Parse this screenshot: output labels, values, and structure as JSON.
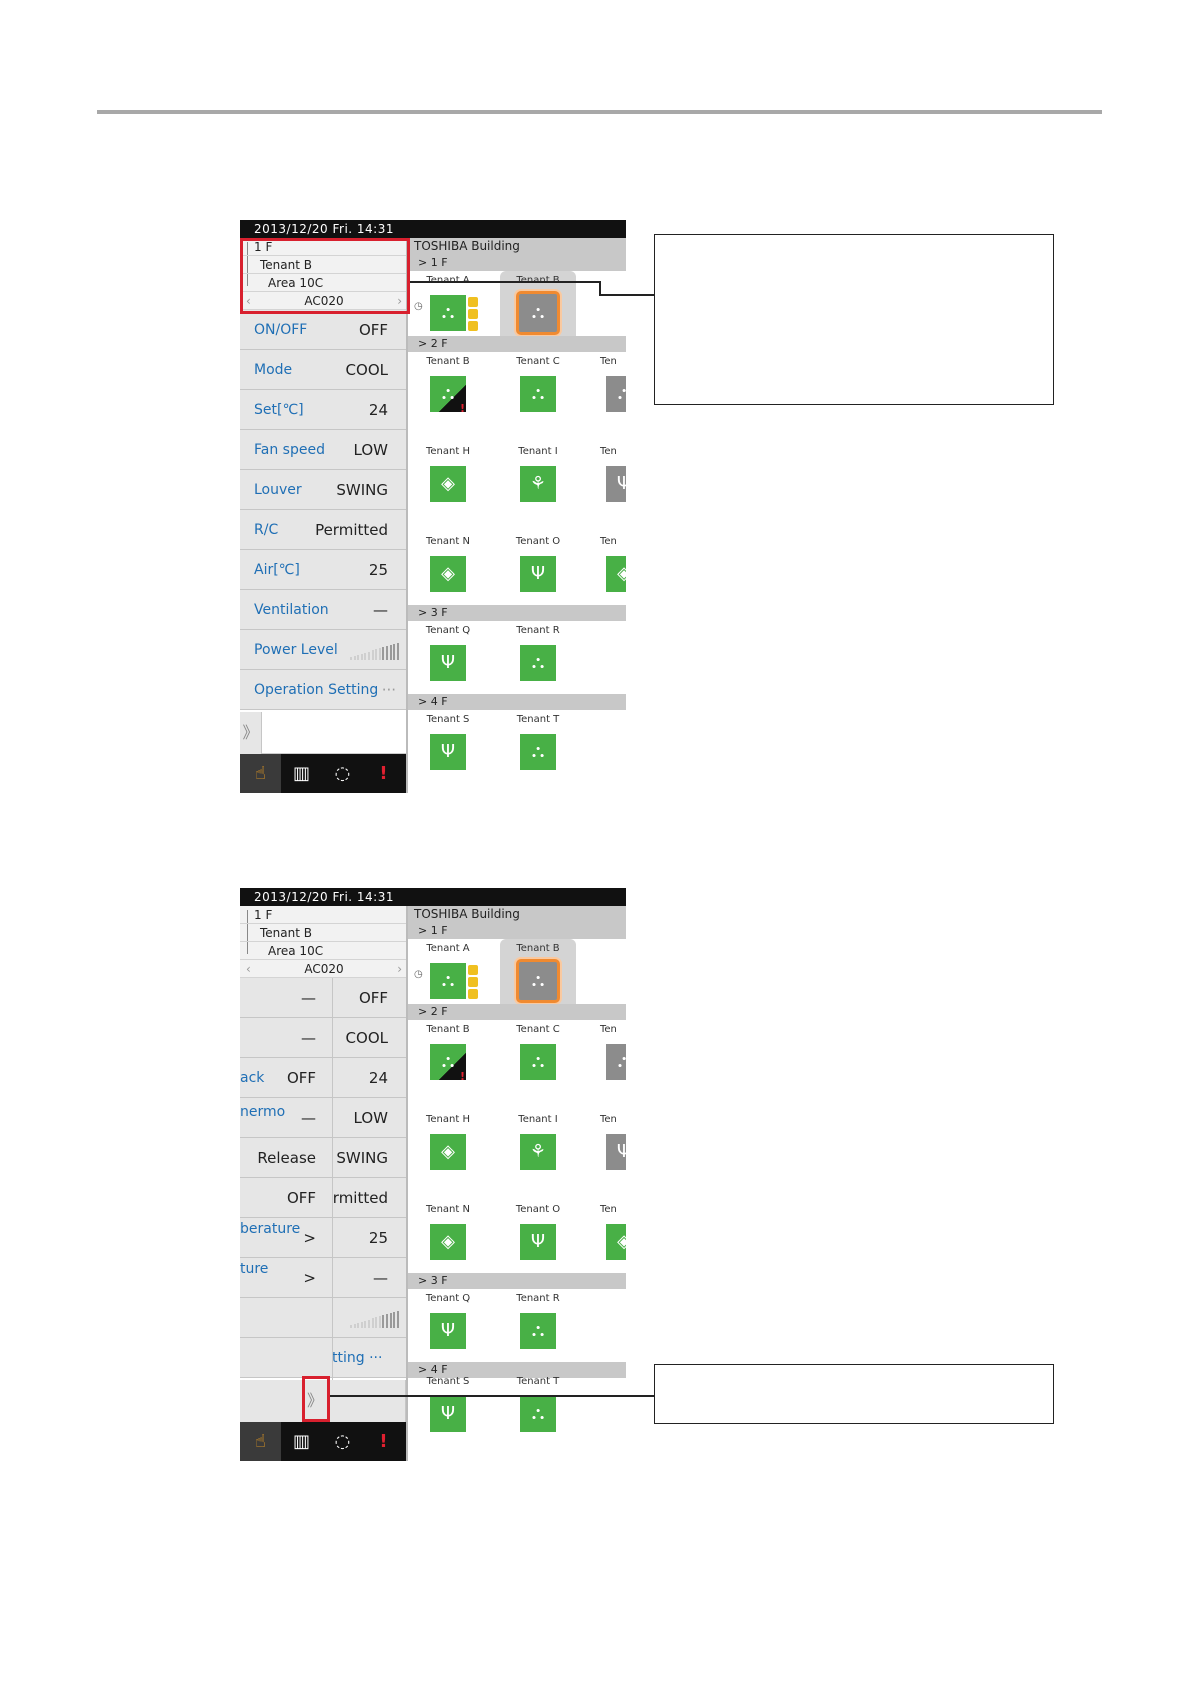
{
  "screen": {
    "datetime": "2013/12/20  Fri.  14:31",
    "tree": {
      "floor": "1 F",
      "tenant": "Tenant B",
      "area": "Area 10C",
      "unit": "AC020"
    },
    "settings": [
      {
        "label": "ON/OFF",
        "value": "OFF"
      },
      {
        "label": "Mode",
        "value": "COOL"
      },
      {
        "label": "Set[℃]",
        "value": "24"
      },
      {
        "label": "Fan speed",
        "value": "LOW"
      },
      {
        "label": "Louver",
        "value": "SWING"
      },
      {
        "label": "R/C",
        "value": "Permitted"
      },
      {
        "label": "Air[℃]",
        "value": "25"
      },
      {
        "label": "Ventilation",
        "value": "—"
      },
      {
        "label": "Power Level",
        "value": "",
        "level": 0.4
      },
      {
        "label": "Operation Setting",
        "value": "···"
      }
    ],
    "expand_label": "》",
    "toolbar": [
      {
        "icon": "hand-pointer-icon",
        "glyph": "☝",
        "active": true
      },
      {
        "icon": "schedule-book-icon",
        "glyph": "▥",
        "active": false
      },
      {
        "icon": "loading-circle-icon",
        "glyph": "◌",
        "active": false
      },
      {
        "icon": "alert-icon",
        "glyph": "!",
        "active": false
      }
    ],
    "building": "TOSHIBA Building",
    "floors": [
      {
        "label": "> 1 F"
      },
      {
        "label": "> 2 F"
      },
      {
        "label": "> 3 F"
      },
      {
        "label": "> 4 F"
      }
    ],
    "tenants": {
      "a": "Tenant A",
      "b": "Tenant B",
      "c": "Tenant C",
      "h": "Tenant H",
      "i": "Tenant I",
      "n": "Tenant N",
      "o": "Tenant O",
      "q": "Tenant Q",
      "r": "Tenant R",
      "s": "Tenant S",
      "t": "Tenant T",
      "partial": "Ten"
    },
    "icon_glyphs": {
      "meeting": "⛬",
      "fan": "◈",
      "dining": "Ψ",
      "people": "⚘",
      "alert": "!",
      "clock": "◷"
    }
  },
  "screen2": {
    "settings": [
      {
        "mid": "—",
        "value": "OFF",
        "left": ""
      },
      {
        "mid": "—",
        "value": "COOL",
        "left": ""
      },
      {
        "mid": "OFF",
        "value": "24",
        "left": "ack"
      },
      {
        "mid": "—",
        "value": "LOW",
        "left": "nermo"
      },
      {
        "mid": "Release",
        "value": "SWING",
        "left": ""
      },
      {
        "mid": "OFF",
        "value": "rmitted",
        "left": ""
      },
      {
        "mid": ">",
        "value": "25",
        "left": "berature"
      },
      {
        "mid": ">",
        "value": "—",
        "left": "ture"
      },
      {
        "mid": "",
        "value": "",
        "left": ""
      },
      {
        "mid": "",
        "value": "tting ···",
        "left": ""
      }
    ]
  },
  "colors": {
    "accent_blue": "#1f6fb5",
    "icon_green": "#48b046",
    "highlight_red": "#d8202e",
    "select_orange": "#f08a30"
  }
}
